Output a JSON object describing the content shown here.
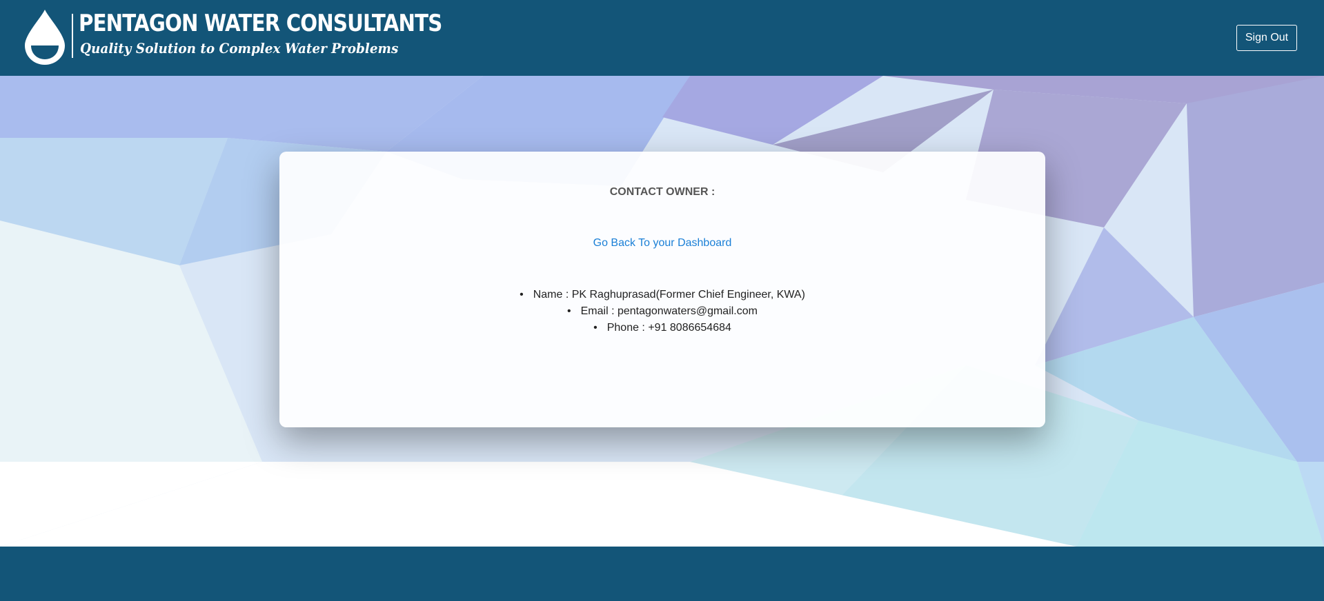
{
  "header": {
    "brand_title": "PENTAGON WATER CONSULTANTS",
    "tagline": "Quality Solution to Complex Water Problems",
    "signout_label": "Sign Out"
  },
  "card": {
    "title": "CONTACT OWNER :",
    "dashboard_link": "Go Back To your Dashboard",
    "contacts": [
      "Name : PK Raghuprasad(Former Chief Engineer, KWA)",
      "Email : pentagonwaters@gmail.com",
      "Phone : +91 8086654684"
    ]
  },
  "colors": {
    "header_bg": "#135578",
    "link": "#1a7fd6"
  }
}
